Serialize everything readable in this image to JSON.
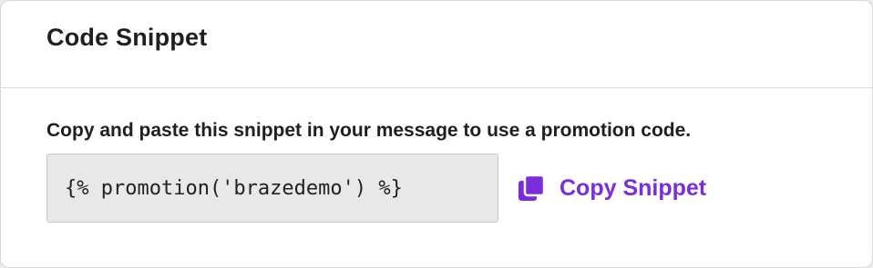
{
  "panel": {
    "title": "Code Snippet",
    "description": "Copy and paste this snippet in your message to use a promotion code.",
    "snippet": "{% promotion('brazedemo') %}",
    "copy_button": {
      "label": "Copy Snippet",
      "icon": "copy-icon"
    }
  },
  "colors": {
    "accent": "#7b2ddb",
    "snippet_bg": "#e8e8e8",
    "text": "#1f1f1f"
  }
}
